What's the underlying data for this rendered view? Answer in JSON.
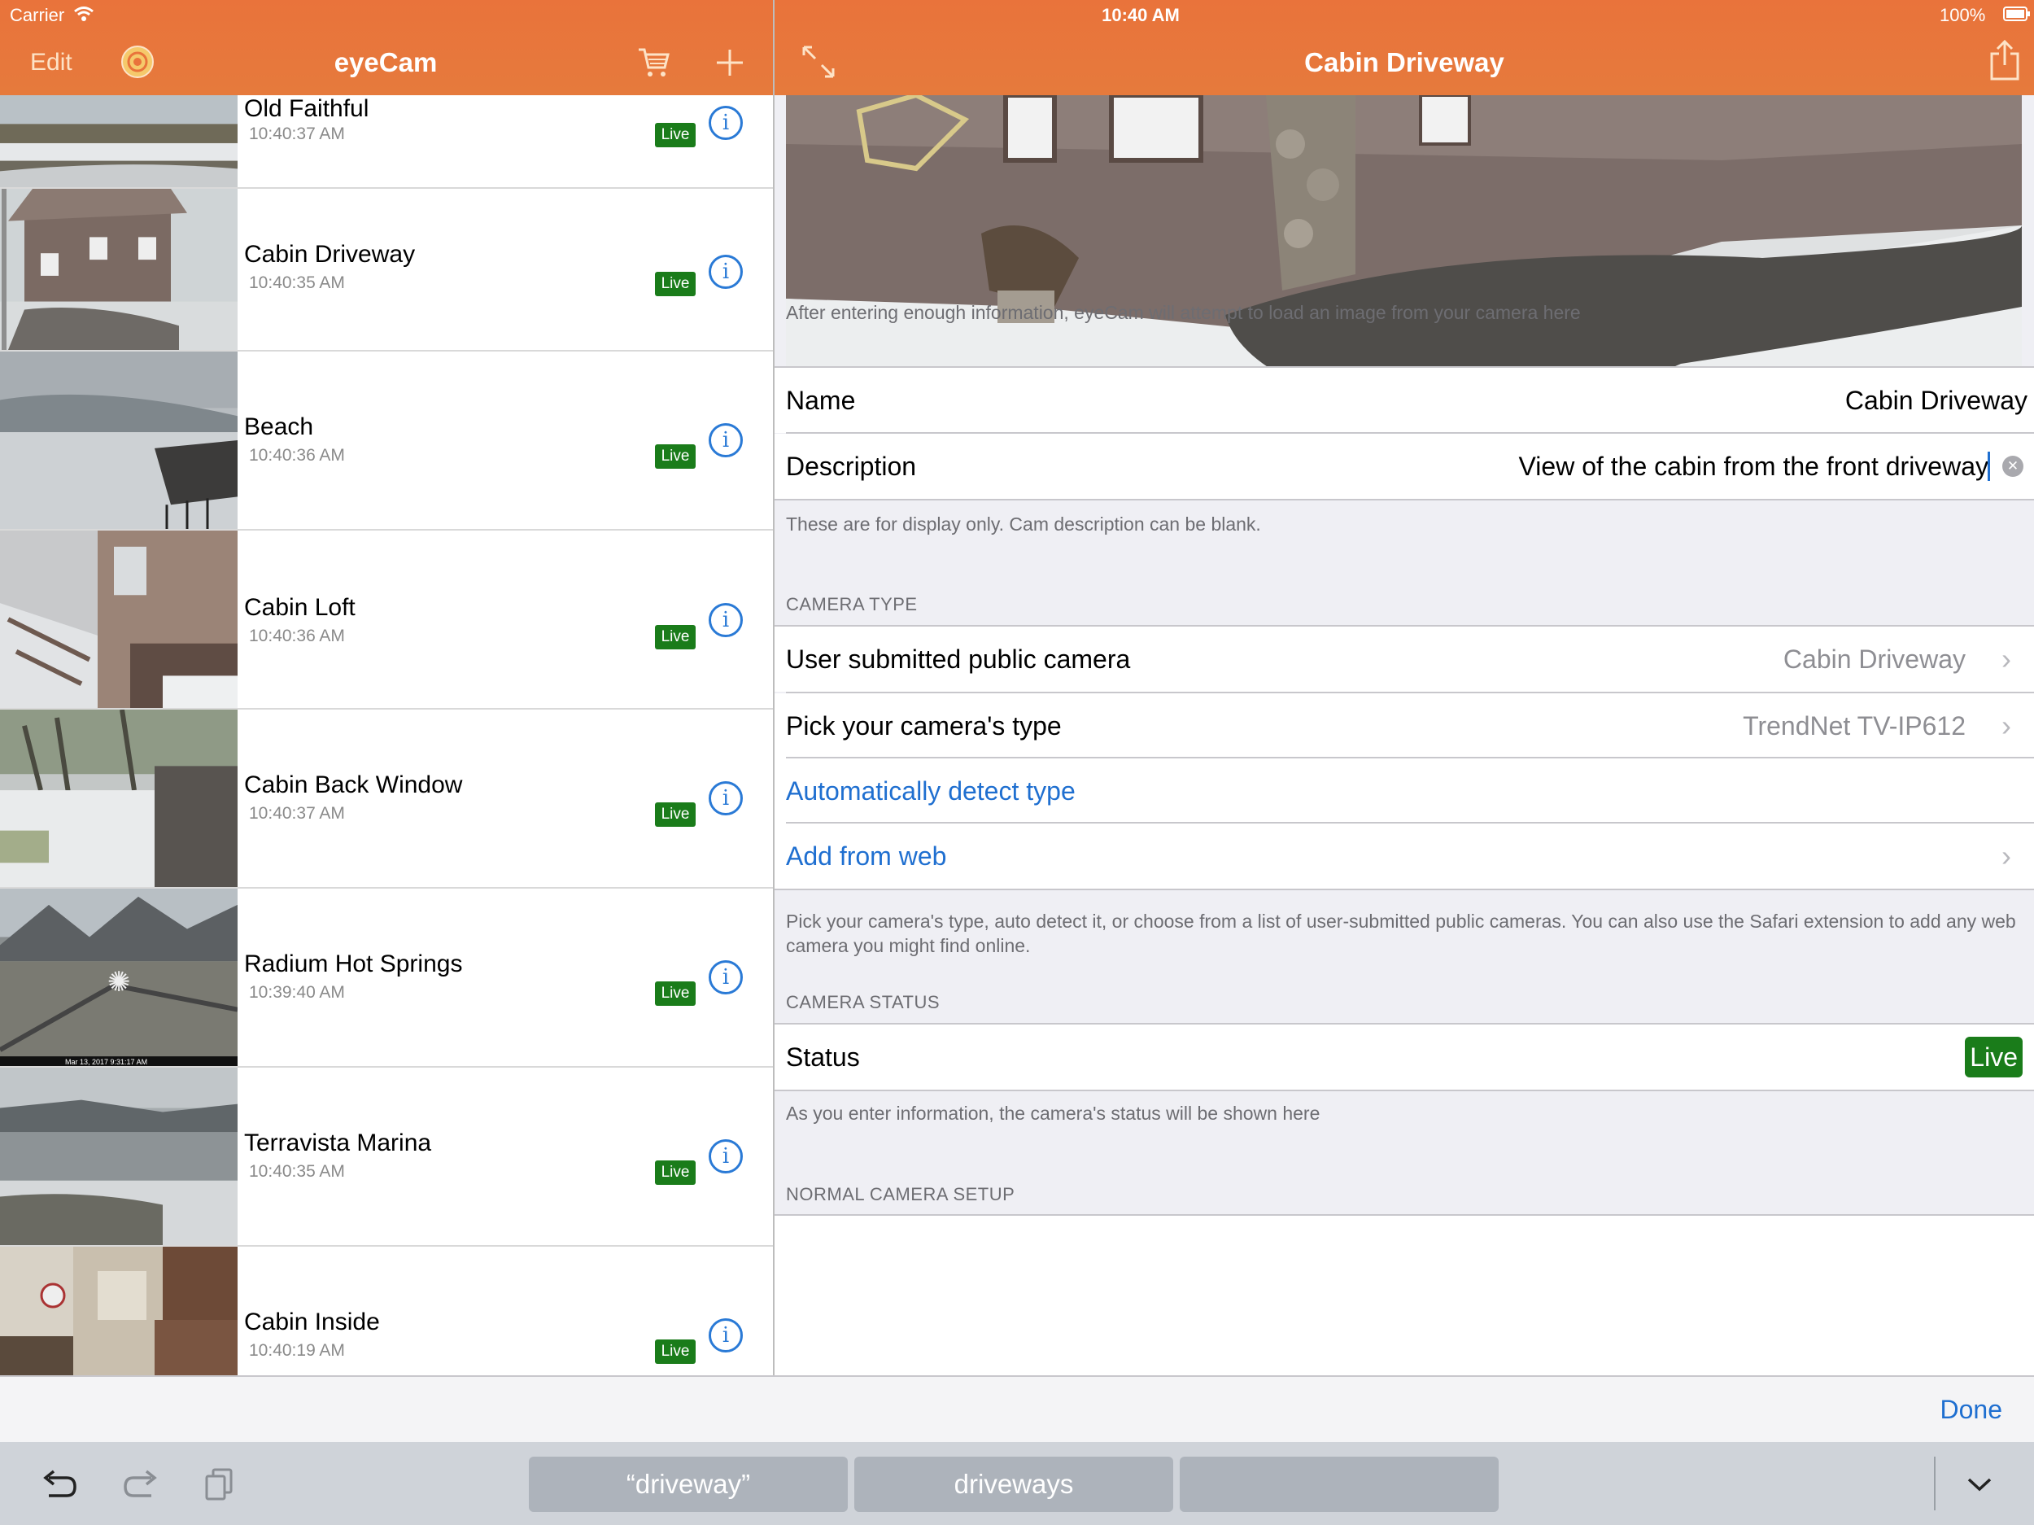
{
  "status_bar": {
    "carrier": "Carrier",
    "time": "10:40 AM",
    "battery": "100%"
  },
  "left_nav": {
    "edit_label": "Edit",
    "title": "eyeCam",
    "icons": [
      "recorder-icon",
      "cart-icon",
      "plus-icon"
    ]
  },
  "cameras": [
    {
      "name": "Old Faithful",
      "time": "10:40:37 AM",
      "status": "Live"
    },
    {
      "name": "Cabin Driveway",
      "time": "10:40:35 AM",
      "status": "Live"
    },
    {
      "name": "Beach",
      "time": "10:40:36 AM",
      "status": "Live"
    },
    {
      "name": "Cabin Loft",
      "time": "10:40:36 AM",
      "status": "Live"
    },
    {
      "name": "Cabin Back Window",
      "time": "10:40:37 AM",
      "status": "Live"
    },
    {
      "name": "Radium Hot Springs",
      "time": "10:39:40 AM",
      "status": "Live",
      "overlay": "Mar 13, 2017 9:31:17 AM"
    },
    {
      "name": "Terravista Marina",
      "time": "10:40:35 AM",
      "status": "Live"
    },
    {
      "name": "Cabin Inside",
      "time": "10:40:19 AM",
      "status": "Live"
    }
  ],
  "detail": {
    "title": "Cabin Driveway",
    "preview_note": "After entering enough information, eyeCam will attempt to load an image from your camera here",
    "name_label": "Name",
    "name_value": "Cabin Driveway",
    "description_label": "Description",
    "description_value": "View of the cabin from the front driveway",
    "display_note": "These are for display only.  Cam description can be blank.",
    "camera_type_header": "CAMERA TYPE",
    "public_camera_label": "User submitted public camera",
    "public_camera_value": "Cabin Driveway",
    "pick_type_label": "Pick your camera's type",
    "pick_type_value": "TrendNet TV-IP612",
    "auto_detect_label": "Automatically detect type",
    "add_from_web_label": "Add from web",
    "type_note": "Pick your camera's type, auto detect it, or choose from a list of user-submitted public cameras.  You can also use the Safari extension to add any web camera you might find online.",
    "camera_status_header": "CAMERA STATUS",
    "status_label": "Status",
    "status_value": "Live",
    "status_note": "As you enter information, the camera's status will be shown here",
    "normal_setup_header": "NORMAL CAMERA SETUP"
  },
  "keyboard": {
    "done_label": "Done",
    "suggestions": [
      "“driveway”",
      "driveways",
      ""
    ]
  },
  "colors": {
    "nav_orange": "#e9733b",
    "live_green": "#1a7c1a",
    "link_blue": "#1f6fd0"
  }
}
